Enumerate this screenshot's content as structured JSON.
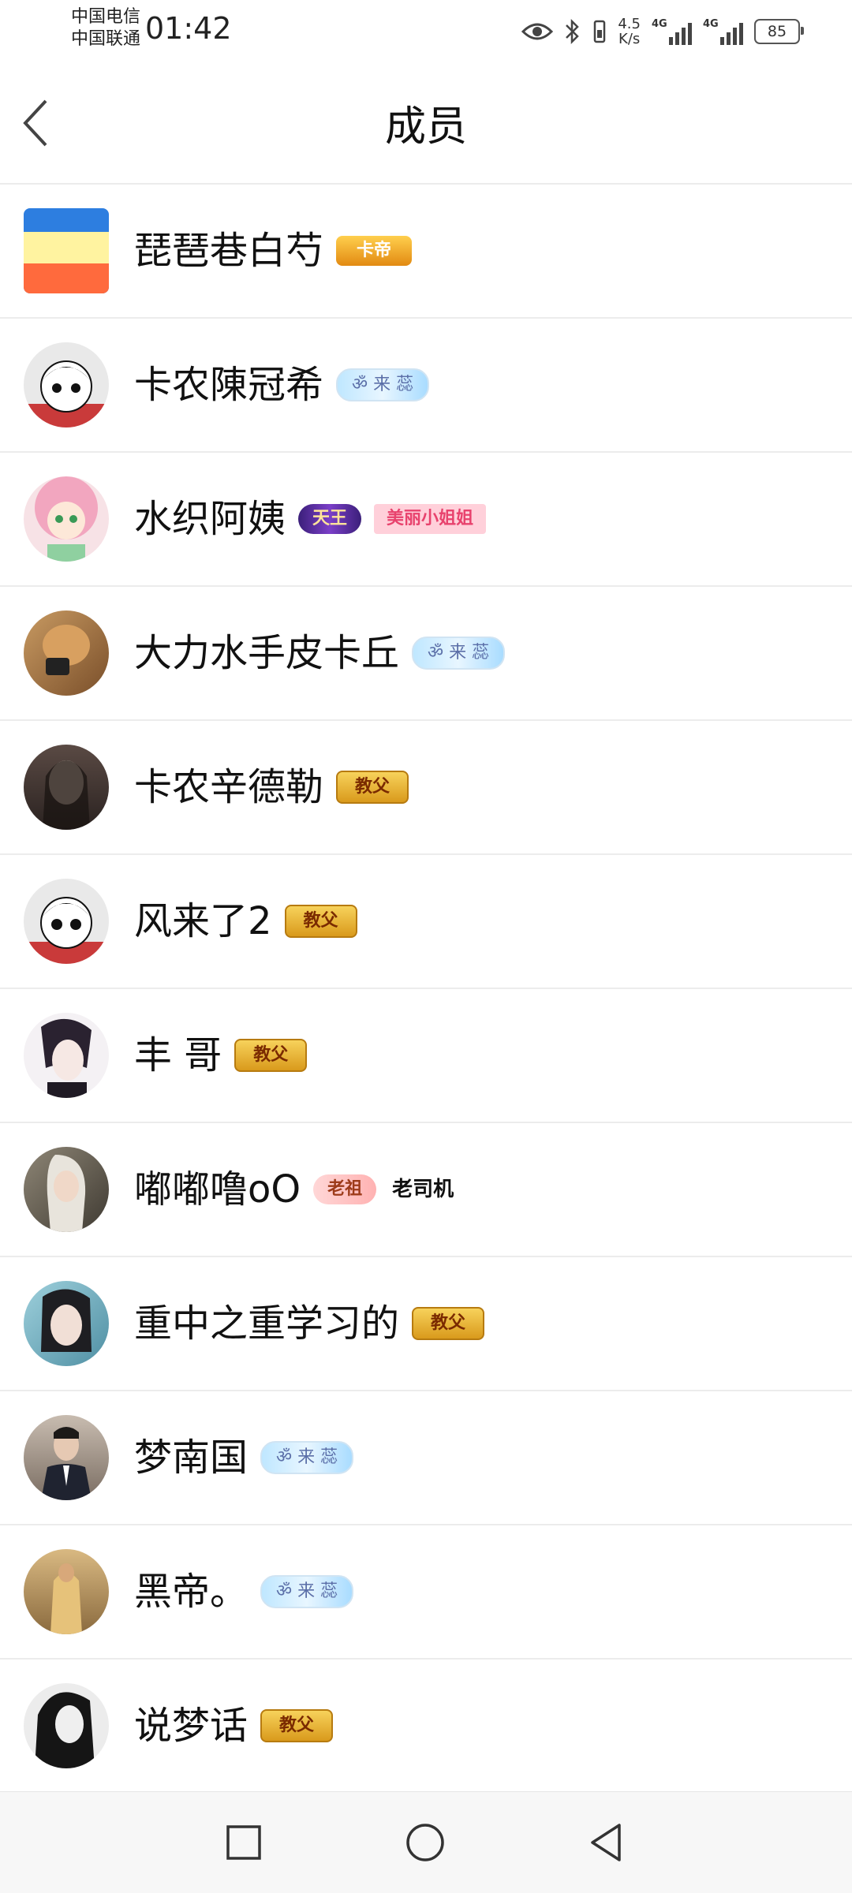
{
  "status_bar": {
    "carrier_1": "中国电信",
    "carrier_2": "中国联通",
    "time": "01:42",
    "net_speed_value": "4.5",
    "net_speed_unit": "K/s",
    "signal_1_label": "4G",
    "signal_2_label": "4G",
    "battery": "85"
  },
  "header": {
    "title": "成员"
  },
  "members": [
    {
      "name": "琵琶巷白芍",
      "badges": [
        "卡帝"
      ],
      "avatar_color": "#2d7ee0"
    },
    {
      "name": "卡农陳冠希",
      "badges": [
        "ॐ 来 蕊"
      ],
      "avatar_color": "#f0f0f0"
    },
    {
      "name": "水织阿姨",
      "badges": [
        "天王",
        "美丽小姐姐"
      ],
      "avatar_color": "#f4c3cf"
    },
    {
      "name": "大力水手皮卡丘",
      "badges": [
        "ॐ 来 蕊"
      ],
      "avatar_color": "#b07a3c"
    },
    {
      "name": "卡农辛德勒",
      "badges": [
        "教父"
      ],
      "avatar_color": "#3c3230"
    },
    {
      "name": "风来了2",
      "badges": [
        "教父"
      ],
      "avatar_color": "#f0f0f0"
    },
    {
      "name": "丰 哥",
      "badges": [
        "教父"
      ],
      "avatar_color": "#2a2230"
    },
    {
      "name": "嘟嘟噜oO",
      "badges": [
        "老祖",
        "老司机"
      ],
      "avatar_color": "#6b6458"
    },
    {
      "name": "重中之重学习的",
      "badges": [
        "教父"
      ],
      "avatar_color": "#7fb8c8"
    },
    {
      "name": "梦南国",
      "badges": [
        "ॐ 来 蕊"
      ],
      "avatar_color": "#8a7a6c"
    },
    {
      "name": "黑帝。",
      "badges": [
        "ॐ 来 蕊"
      ],
      "avatar_color": "#b89060"
    },
    {
      "name": "说梦话",
      "badges": [
        "教父"
      ],
      "avatar_color": "#222222"
    }
  ]
}
